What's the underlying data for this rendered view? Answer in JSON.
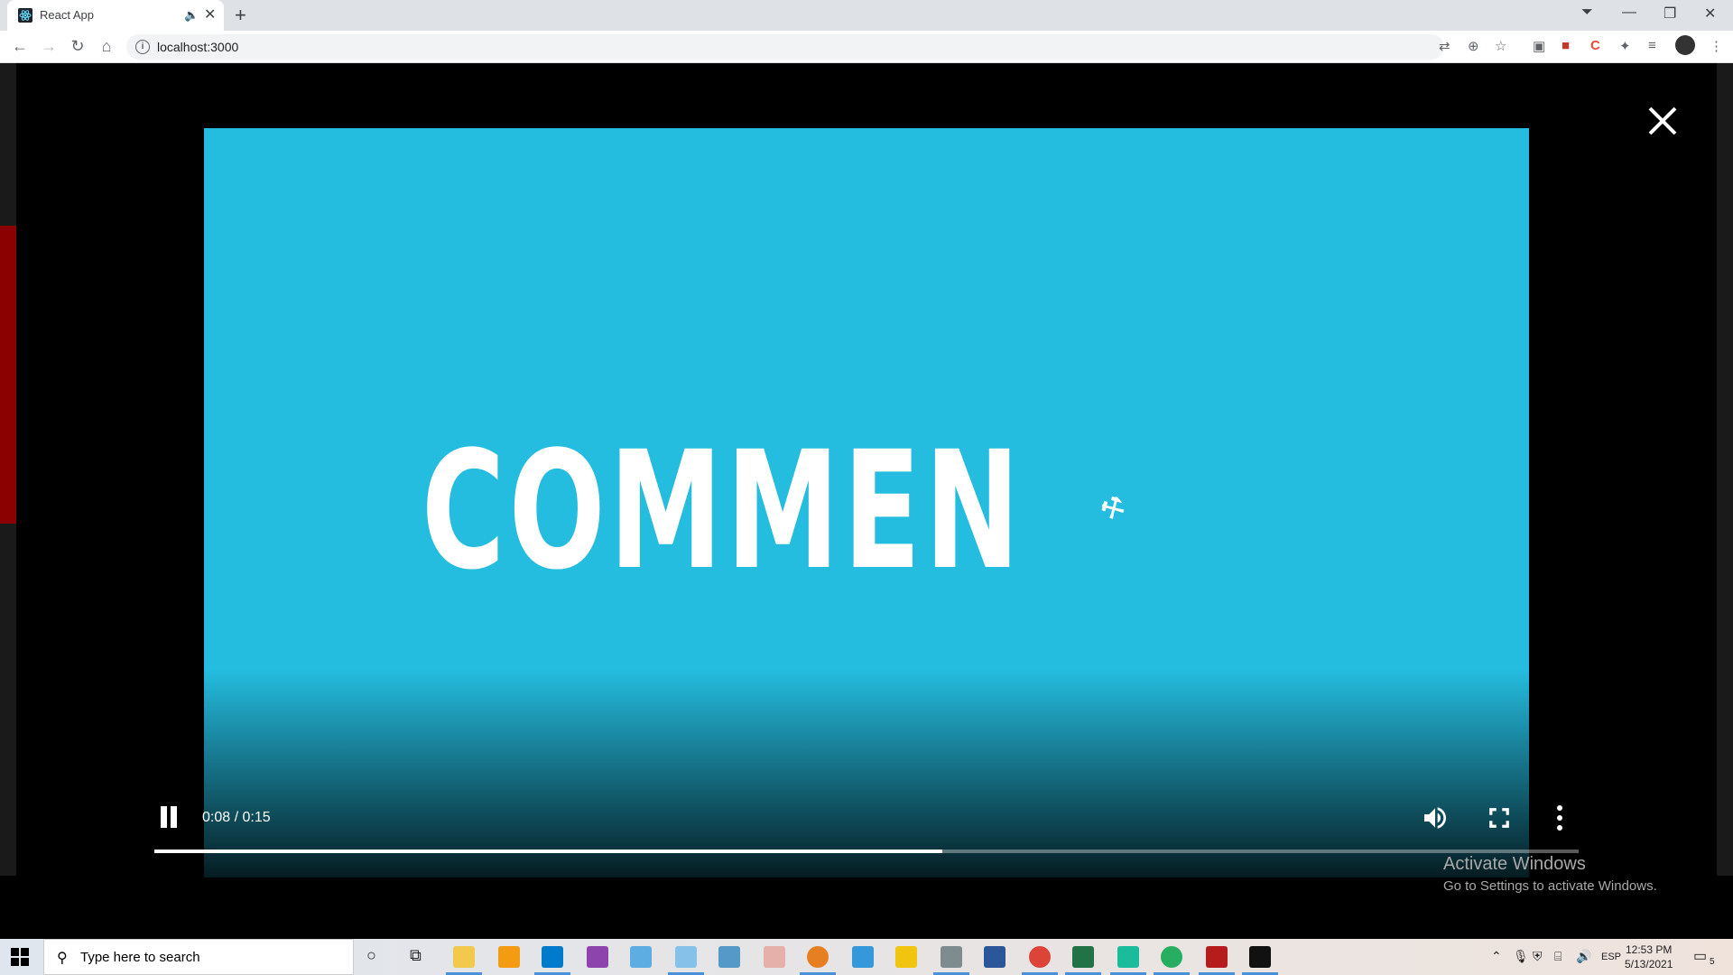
{
  "browser": {
    "tab_title": "React App",
    "tab_audio_icon": "speaker-icon",
    "new_tab": "+",
    "url": "localhost:3000",
    "window_controls": [
      "minimize",
      "restore",
      "close"
    ]
  },
  "modal": {
    "close_icon": "close-icon"
  },
  "video": {
    "caption": "COMMEN",
    "current_time": "0:08 / 0:15",
    "progress": 0.553,
    "controls": [
      "pause",
      "volume",
      "fullscreen",
      "more-options"
    ]
  },
  "watermark": {
    "line1": "Activate Windows",
    "line2": "Go to Settings to activate Windows."
  },
  "taskbar": {
    "search_placeholder": "Type here to search",
    "language": "ESP",
    "time": "12:53 PM",
    "date": "5/13/2021",
    "notifications": "5"
  },
  "colors": {
    "video_bg": "#24bcdf",
    "chrome_bg": "#dee1e6"
  }
}
